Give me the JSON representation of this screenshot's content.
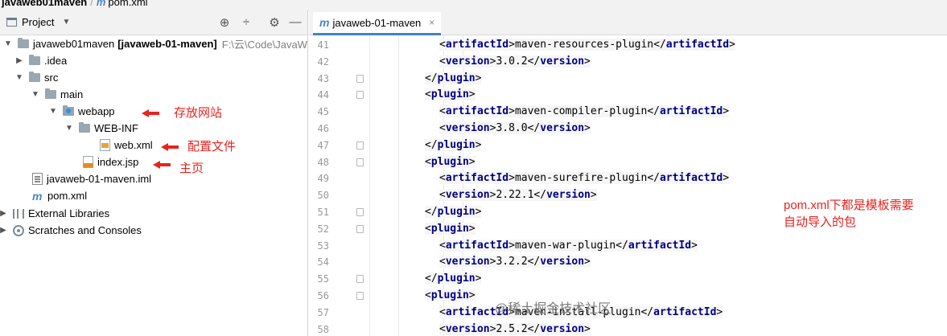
{
  "breadcrumb": {
    "root": "javaweb01maven",
    "file": "pom.xml"
  },
  "project_panel": {
    "title": "Project",
    "toolbar_icons": [
      "crosshair-icon",
      "collapse-icon",
      "gear-icon",
      "minimize-icon"
    ],
    "tree": [
      {
        "label": "javaweb01maven",
        "module": "[javaweb-01-maven]",
        "path": "F:\\云\\Code\\JavaW",
        "icon": "module-folder-icon",
        "expanded": true
      },
      {
        "label": ".idea",
        "icon": "folder-icon",
        "expanded": false
      },
      {
        "label": "src",
        "icon": "folder-icon",
        "expanded": true
      },
      {
        "label": "main",
        "icon": "folder-icon",
        "expanded": true
      },
      {
        "label": "webapp",
        "icon": "web-folder-icon",
        "expanded": true
      },
      {
        "label": "WEB-INF",
        "icon": "folder-icon",
        "expanded": true
      },
      {
        "label": "web.xml",
        "icon": "xml-file-icon"
      },
      {
        "label": "index.jsp",
        "icon": "jsp-file-icon"
      },
      {
        "label": "javaweb-01-maven.iml",
        "icon": "iml-file-icon"
      },
      {
        "label": "pom.xml",
        "icon": "maven-icon"
      },
      {
        "label": "External Libraries",
        "icon": "library-icon",
        "expanded": false
      },
      {
        "label": "Scratches and Consoles",
        "icon": "scratches-icon",
        "expanded": false
      }
    ]
  },
  "annotations": {
    "webapp": "存放网站",
    "web_xml": "配置文件",
    "index_jsp": "主页",
    "pom_note_line1": "pom.xml下都是模板需要",
    "pom_note_line2": "自动导入的包"
  },
  "editor": {
    "tab_label": "javaweb-01-maven",
    "lines": [
      {
        "n": "41",
        "open": "<artifactId>",
        "text": "maven-resources-plugin",
        "close": "</artifactId>"
      },
      {
        "n": "42",
        "open": "<version>",
        "text": "3.0.2",
        "close": "</version>"
      },
      {
        "n": "43",
        "open": "",
        "text": "",
        "close": "</plugin>"
      },
      {
        "n": "44",
        "open": "<plugin>",
        "text": "",
        "close": ""
      },
      {
        "n": "45",
        "open": "<artifactId>",
        "text": "maven-compiler-plugin",
        "close": "</artifactId>"
      },
      {
        "n": "46",
        "open": "<version>",
        "text": "3.8.0",
        "close": "</version>"
      },
      {
        "n": "47",
        "open": "",
        "text": "",
        "close": "</plugin>"
      },
      {
        "n": "48",
        "open": "<plugin>",
        "text": "",
        "close": ""
      },
      {
        "n": "49",
        "open": "<artifactId>",
        "text": "maven-surefire-plugin",
        "close": "</artifactId>"
      },
      {
        "n": "50",
        "open": "<version>",
        "text": "2.22.1",
        "close": "</version>"
      },
      {
        "n": "51",
        "open": "",
        "text": "",
        "close": "</plugin>"
      },
      {
        "n": "52",
        "open": "<plugin>",
        "text": "",
        "close": ""
      },
      {
        "n": "53",
        "open": "<artifactId>",
        "text": "maven-war-plugin",
        "close": "</artifactId>"
      },
      {
        "n": "54",
        "open": "<version>",
        "text": "3.2.2",
        "close": "</version>"
      },
      {
        "n": "55",
        "open": "",
        "text": "",
        "close": "</plugin>"
      },
      {
        "n": "56",
        "open": "<plugin>",
        "text": "",
        "close": ""
      },
      {
        "n": "57",
        "open": "<artifactId>",
        "text": "maven-install-plugin",
        "close": "</artifactId>"
      },
      {
        "n": "58",
        "open": "<version>",
        "text": "2.5.2",
        "close": "</version>"
      }
    ]
  },
  "watermark": "@稀土掘金技术社区",
  "colors": {
    "xml_tag": "#000080",
    "annotation_red": "#e8231f",
    "line_number": "#999999",
    "tab_underline": "#4083c9"
  }
}
